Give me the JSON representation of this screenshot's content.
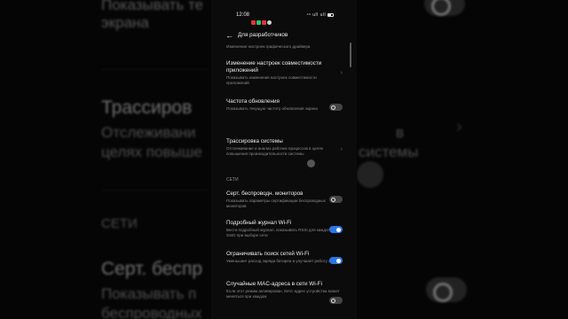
{
  "status_bar": {
    "time": "12:08",
    "right_text": "⁴ˢ ull ull"
  },
  "header": {
    "title": "Для разработчиков"
  },
  "items": [
    {
      "title": "",
      "subtitle": "Изменение настроек графического драйвера",
      "control": "none"
    },
    {
      "title": "Изменение настроек совместимости приложений",
      "subtitle": "Показывать изменения настроек совместимости приложений",
      "control": "chevron"
    },
    {
      "title": "Частота обновления",
      "subtitle": "Показывать текущую частоту обновления экрана",
      "control": "toggle",
      "on": false
    },
    {
      "title": "Трассировка системы",
      "subtitle": "Отслеживание и анализ рабочих процессов в целях повышения производительности системы",
      "control": "chevron"
    },
    {
      "title": "Серт. беспроводн. мониторов",
      "subtitle": "Показывать параметры сертификации беспроводных мониторов",
      "control": "toggle",
      "on": false
    },
    {
      "title": "Подробный журнал Wi-Fi",
      "subtitle": "Вести подробный журнал, показывать RSSI для каждого SSID при выборе сети",
      "control": "toggle",
      "on": true
    },
    {
      "title": "Ограничивать поиск сетей Wi-Fi",
      "subtitle": "Уменьшает расход заряда батареи и улучшает работу сети",
      "control": "toggle",
      "on": true
    },
    {
      "title": "Случайные MAC-адреса в сети Wi-Fi",
      "subtitle": "Если этот режим активирован, MAC-адрес устройства может меняться при каждом",
      "control": "toggle",
      "on": false
    }
  ],
  "section_networks": "СЕТИ",
  "background": {
    "line1": "Показывать те",
    "line2": "экрана",
    "line3": "Трассиров",
    "line4": "Отслеживани",
    "line5": "целях повыше",
    "line6": "СЕТИ",
    "line7": "Серт. беспр",
    "line8": "Показывать п",
    "line9": "беспроводных",
    "right1": "в",
    "right2": "системы"
  },
  "colors": {
    "accent": "#2a76e6",
    "background": "#000000"
  }
}
